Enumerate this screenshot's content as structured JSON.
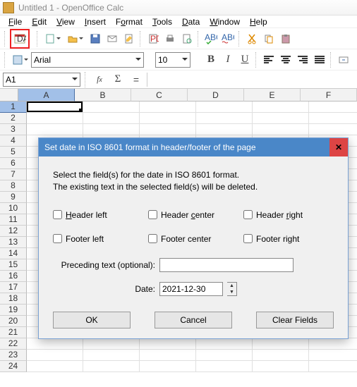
{
  "window": {
    "title": "Untitled 1 - OpenOffice Calc"
  },
  "menu": [
    "File",
    "Edit",
    "View",
    "Insert",
    "Format",
    "Tools",
    "Data",
    "Window",
    "Help"
  ],
  "toolbar2": {
    "font": "Arial",
    "size": "10"
  },
  "formula_bar": {
    "name_box": "A1",
    "formula": ""
  },
  "columns": [
    "A",
    "B",
    "C",
    "D",
    "E",
    "F"
  ],
  "row_count": 24,
  "dialog": {
    "title": "Set date in ISO 8601 format in header/footer of the page",
    "desc1": "Select the field(s) for the date in ISO 8601 format.",
    "desc2": "The existing text in the selected field(s) will be deleted.",
    "checks": {
      "header_left": "Header left",
      "header_center": "Header center",
      "header_right": "Header right",
      "footer_left": "Footer left",
      "footer_center": "Footer center",
      "footer_right": "Footer right"
    },
    "preceding_label": "Preceding text (optional):",
    "preceding_value": "",
    "date_label": "Date:",
    "date_value": "2021-12-30",
    "buttons": {
      "ok": "OK",
      "cancel": "Cancel",
      "clear": "Clear Fields"
    }
  }
}
